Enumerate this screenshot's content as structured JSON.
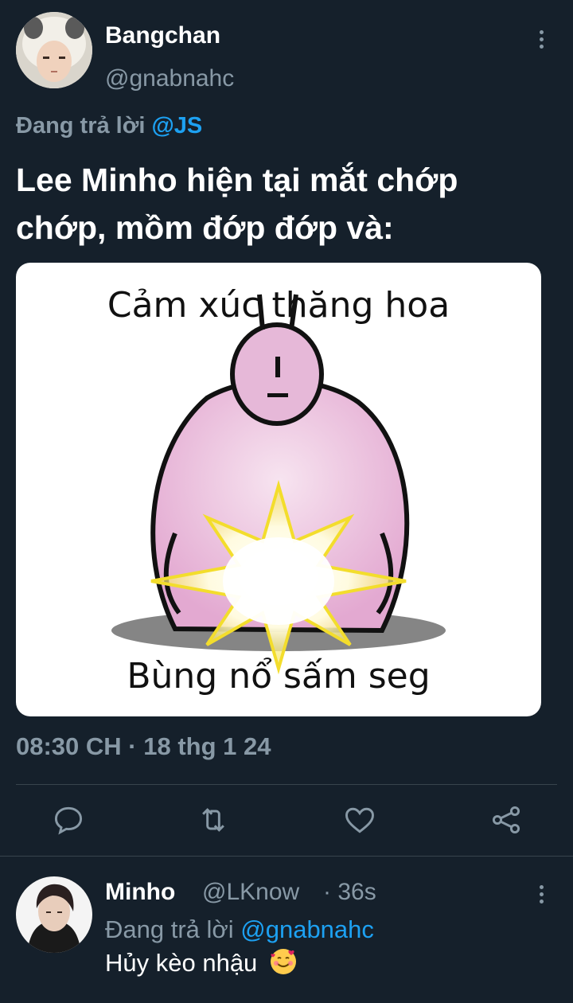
{
  "main_tweet": {
    "display_name": "Bangchan",
    "handle": "@gnabnahc",
    "replying_to_prefix": "Đang trả lời",
    "replying_to_mention": "@JS",
    "text": "Lee Minho hiện tại mắt chớp chớp, mồm đớp đớp và:",
    "media": {
      "caption_top": "Cảm xúc thăng hoa",
      "caption_bottom": "Bùng nổ sấm seg"
    },
    "timestamp": "08:30 CH · 18 thg 1 24",
    "actions": {
      "reply_icon": "reply-icon",
      "retweet_icon": "retweet-icon",
      "like_icon": "heart-icon",
      "share_icon": "share-icon"
    }
  },
  "reply_tweet": {
    "display_name": "Minho",
    "handle": "@LKnow",
    "time": "· 36s",
    "replying_to_prefix": "Đang trả lời",
    "replying_to_mention": "@gnabnahc",
    "text": "Hủy kèo nhậu",
    "emoji_icon": "smiling-face-with-hearts-icon"
  },
  "colors": {
    "background": "#15202b",
    "secondary_text": "#8899a6",
    "accent": "#1da1f2",
    "divider": "#38444d"
  }
}
